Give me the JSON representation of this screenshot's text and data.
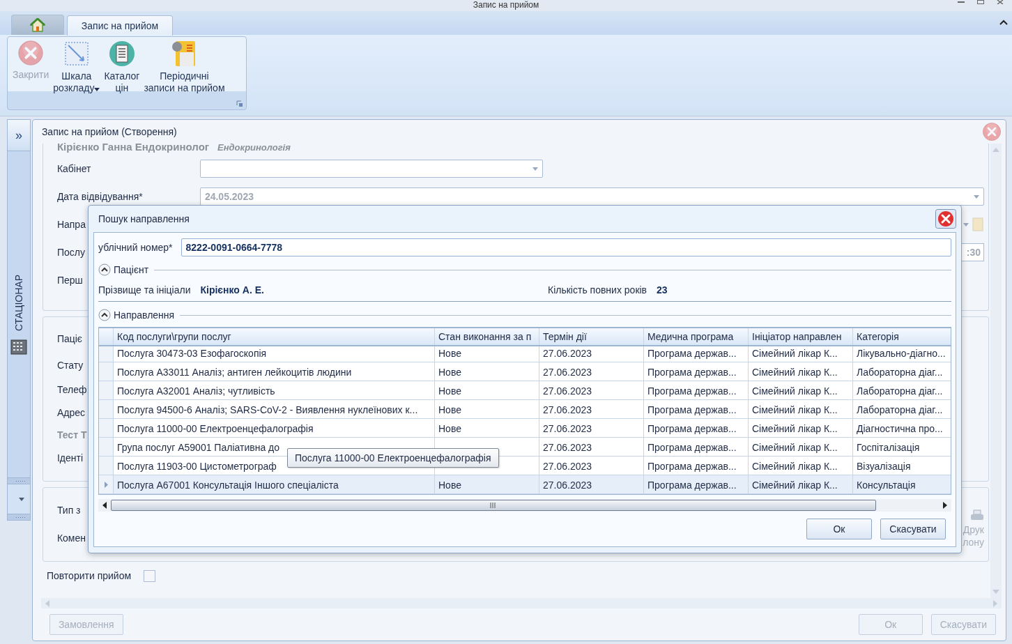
{
  "window": {
    "title": "Запис на прийом"
  },
  "ribbon": {
    "tabs": [
      {
        "kind": "home",
        "selected": false
      },
      {
        "kind": "text",
        "label": "Запис на прийом",
        "selected": true
      }
    ],
    "buttons": [
      {
        "label": "Закрити",
        "disabled": true,
        "dropdown": false
      },
      {
        "label": "Шкала\nрозкладу",
        "disabled": false,
        "dropdown": true
      },
      {
        "label": "Каталог\nцін",
        "disabled": false,
        "dropdown": false
      },
      {
        "label": "Періодичні\nзаписи на прийом",
        "disabled": false,
        "dropdown": false
      }
    ]
  },
  "sidebar": {
    "expand": "»",
    "label": "СТАЦІОНАР"
  },
  "form": {
    "title": "Запис на прийом (Створення)",
    "doctor": "Кірієнко Ганна Ендокринолог",
    "specialty": "Ендокринологія",
    "groups": [
      {
        "rows": [
          {
            "label": "Кабінет",
            "kind": "combo"
          },
          {
            "label": "Дата відвідування*",
            "kind": "date",
            "value": "24.05.2023",
            "disabled": true
          },
          {
            "label": "Напра",
            "kind": "stub"
          },
          {
            "label": "Послу",
            "kind": "time",
            "value": ":30",
            "disabled": true
          },
          {
            "label": "Перш",
            "kind": "label"
          }
        ]
      },
      {
        "rows": [
          {
            "label": "Паціє",
            "kind": "label"
          },
          {
            "label": "Стату",
            "kind": "label"
          },
          {
            "label": "Телеф",
            "kind": "label"
          },
          {
            "label": "Адрес",
            "kind": "label"
          },
          {
            "label": "Тест Т",
            "kind": "heading"
          },
          {
            "label": "Іденті",
            "kind": "label"
          }
        ]
      },
      {
        "rows": [
          {
            "label": "Тип з",
            "kind": "label"
          },
          {
            "label": "Комен",
            "kind": "label"
          }
        ],
        "side_button": {
          "label": "Друк\nлону",
          "disabled": true
        }
      }
    ],
    "repeat": {
      "label": "Повторити прийом",
      "checked": false
    },
    "buttons": [
      {
        "label": "Замовлення",
        "disabled": true
      },
      {
        "label": "Ок",
        "disabled": true
      },
      {
        "label": "Скасувати",
        "disabled": true
      }
    ]
  },
  "dialog": {
    "title": "Пошук направлення",
    "number": {
      "label": "ублічний номер*",
      "value": "8222-0091-0664-7778"
    },
    "sections": [
      {
        "title": "Пацієнт",
        "expanded": true,
        "fields": [
          {
            "label": "Прізвище та ініціали",
            "value": "Кірієнко А. Е."
          },
          {
            "label": "Кількість повних років",
            "value": "23"
          }
        ]
      },
      {
        "title": "Направлення",
        "expanded": true
      }
    ],
    "table": {
      "columns": [
        "Код послуги\\групи послуг",
        "Стан виконання за п",
        "Термін дії",
        "Медична програма",
        "Ініціатор направлен",
        "Категорія"
      ],
      "rows": [
        {
          "selected": false,
          "cells": [
            "Послуга 30473-03 Езофагоскопія",
            "Нове",
            "27.06.2023",
            "Програма держав...",
            "Сімейний лікар  К...",
            "Лікувально-діагно..."
          ]
        },
        {
          "selected": false,
          "cells": [
            "Послуга A33011 Аналіз; антиген лейкоцитів людини",
            "Нове",
            "27.06.2023",
            "Програма держав...",
            "Сімейний лікар  К...",
            "Лабораторна діаг..."
          ]
        },
        {
          "selected": false,
          "cells": [
            "Послуга A32001 Аналіз; чутливість",
            "Нове",
            "27.06.2023",
            "Програма держав...",
            "Сімейний лікар  К...",
            "Лабораторна діаг..."
          ]
        },
        {
          "selected": false,
          "cells": [
            "Послуга 94500-6 Аналіз; SARS-CoV-2 - Виявлення нуклеїнових к...",
            "Нове",
            "27.06.2023",
            "Програма держав...",
            "Сімейний лікар  К...",
            "Лабораторна діаг..."
          ]
        },
        {
          "selected": false,
          "cells": [
            "Послуга 11000-00 Електроенцефалографія",
            "Нове",
            "27.06.2023",
            "Програма держав...",
            "Сімейний лікар  К...",
            "Діагностична про..."
          ]
        },
        {
          "selected": false,
          "cells": [
            "Група послуг A59001 Паліативна до",
            "",
            "27.06.2023",
            "Програма держав...",
            "Сімейний лікар  К...",
            "Госпіталізація"
          ]
        },
        {
          "selected": false,
          "cells": [
            "Послуга 11903-00 Цистометрограф",
            "",
            "27.06.2023",
            "Програма держав...",
            "Сімейний лікар  К...",
            "Візуалізація"
          ]
        },
        {
          "selected": true,
          "cells": [
            "Послуга A67001 Консультація Іншого спеціаліста",
            "Нове",
            "27.06.2023",
            "Програма держав...",
            "Сімейний лікар  К...",
            "Консультація"
          ]
        }
      ]
    },
    "tooltip": "Послуга 11000-00 Електроенцефалографія",
    "buttons": [
      "Ок",
      "Скасувати"
    ]
  }
}
